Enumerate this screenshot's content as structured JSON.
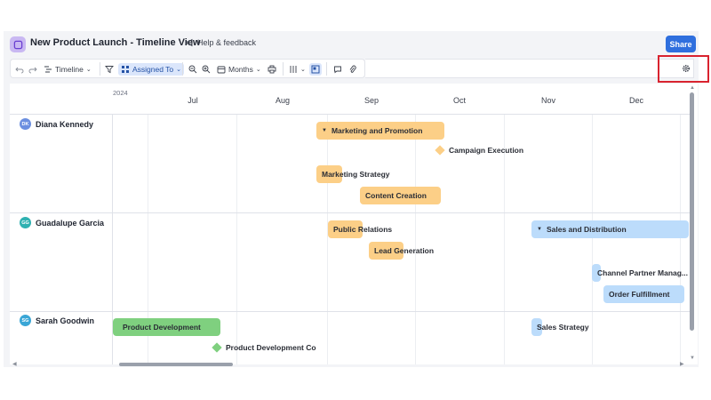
{
  "header": {
    "title": "New Product Launch - Timeline View",
    "help_label": "Help & feedback",
    "share_label": "Share"
  },
  "toolbar": {
    "view_label": "Timeline",
    "group_label": "Assigned To",
    "scale_label": "Months"
  },
  "timeline": {
    "year": "2024",
    "months": [
      "Jul",
      "Aug",
      "Sep",
      "Oct",
      "Nov",
      "Dec"
    ]
  },
  "people": [
    {
      "initials": "DK",
      "name": "Diana Kennedy",
      "color": "#6c8fe0"
    },
    {
      "initials": "GG",
      "name": "Guadalupe Garcia",
      "color": "#2fb1b1"
    },
    {
      "initials": "SG",
      "name": "Sarah Goodwin",
      "color": "#3aa6d6"
    }
  ],
  "tasks": {
    "marketing_promotion": "Marketing and Promotion",
    "campaign_execution": "Campaign Execution",
    "marketing_strategy": "Marketing Strategy",
    "content_creation": "Content Creation",
    "public_relations": "Public Relations",
    "lead_generation": "Lead Generation",
    "sales_distribution": "Sales and Distribution",
    "channel_partner": "Channel Partner Manag...",
    "order_fulfillment": "Order Fulfillment",
    "product_development": "Product Development",
    "product_development_co": "Product Development Co",
    "sales_strategy": "Sales Strategy"
  },
  "colors": {
    "accent": "#2f6fde",
    "task_orange": "#fccf87",
    "task_blue": "#bcdcfb",
    "task_green": "#7fd07f",
    "highlight": "#d9232f"
  }
}
